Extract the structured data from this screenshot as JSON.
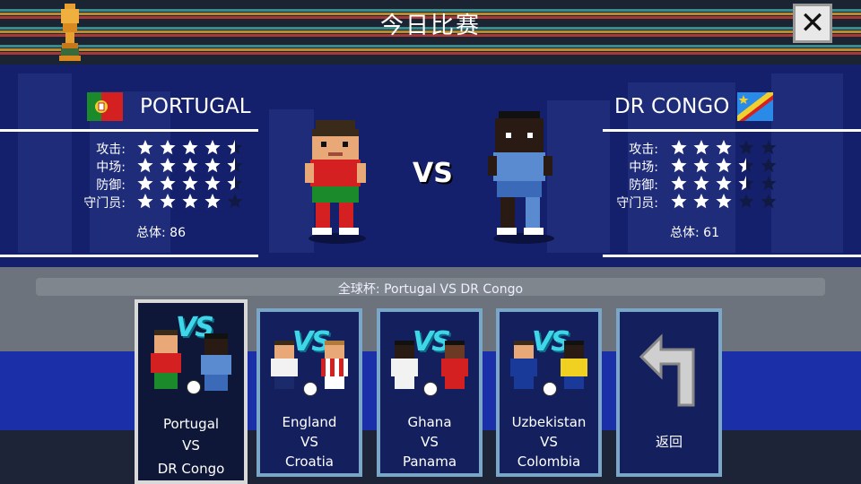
{
  "header": {
    "title": "今日比赛",
    "close_icon": "close-icon"
  },
  "match": {
    "home": {
      "name": "PORTUGAL",
      "flag_icon": "portugal-flag-icon",
      "stats": [
        {
          "label": "攻击:",
          "stars": 4.5
        },
        {
          "label": "中场:",
          "stars": 4.5
        },
        {
          "label": "防御:",
          "stars": 4.5
        },
        {
          "label": "守门员:",
          "stars": 4
        }
      ],
      "overall": "总体:  86"
    },
    "vs_text": "VS",
    "away": {
      "name": "DR CONGO",
      "flag_icon": "dr-congo-flag-icon",
      "stats": [
        {
          "label": "攻击:",
          "stars": 3
        },
        {
          "label": "中场:",
          "stars": 3.5
        },
        {
          "label": "防御:",
          "stars": 3.5
        },
        {
          "label": "守门员:",
          "stars": 3
        }
      ],
      "overall": "总体:  61"
    }
  },
  "subtitle": "全球杯: Portugal VS DR Congo",
  "fixtures": [
    {
      "line1": "Portugal",
      "line2": "VS",
      "line3": "DR Congo",
      "selected": true
    },
    {
      "line1": "England",
      "line2": "VS",
      "line3": "Croatia",
      "selected": false
    },
    {
      "line1": "Ghana",
      "line2": "VS",
      "line3": "Panama",
      "selected": false
    },
    {
      "line1": "Uzbekistan",
      "line2": "VS",
      "line3": "Colombia",
      "selected": false
    }
  ],
  "back_button": {
    "label": "返回",
    "icon": "back-arrow-icon"
  },
  "colors": {
    "star_filled": "#ffffff",
    "star_empty": "#111a44",
    "card_border": "#7aa7c8",
    "selected_border": "#d9d9d9",
    "vs_accent": "#3fd6ea"
  }
}
